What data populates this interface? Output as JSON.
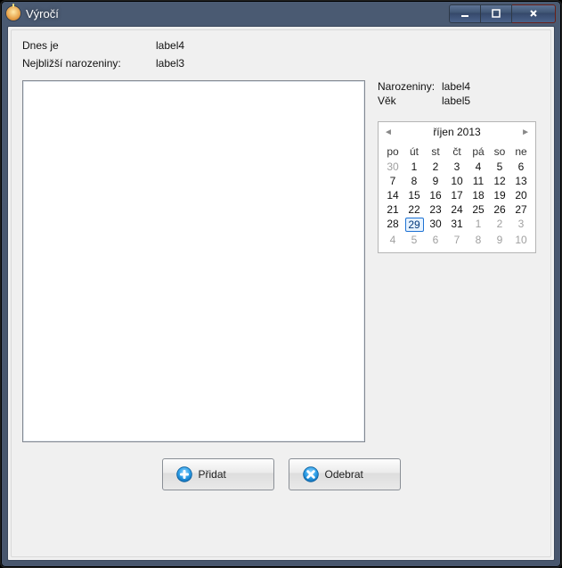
{
  "window": {
    "title": "Výročí"
  },
  "top": {
    "today_label": "Dnes je",
    "today_value": "label4",
    "next_label": "Nejbližší narozeniny:",
    "next_value": "label3"
  },
  "side": {
    "bday_label": "Narozeniny:",
    "bday_value": "label4",
    "age_label": "Věk",
    "age_value": "label5"
  },
  "calendar": {
    "caption": "říjen 2013",
    "prev_glyph": "◄",
    "next_glyph": "►",
    "day_headers": [
      "po",
      "út",
      "st",
      "čt",
      "pá",
      "so",
      "ne"
    ],
    "weeks": [
      [
        {
          "d": 30,
          "other": true
        },
        {
          "d": 1
        },
        {
          "d": 2
        },
        {
          "d": 3
        },
        {
          "d": 4
        },
        {
          "d": 5
        },
        {
          "d": 6
        }
      ],
      [
        {
          "d": 7
        },
        {
          "d": 8
        },
        {
          "d": 9
        },
        {
          "d": 10
        },
        {
          "d": 11
        },
        {
          "d": 12
        },
        {
          "d": 13
        }
      ],
      [
        {
          "d": 14
        },
        {
          "d": 15
        },
        {
          "d": 16
        },
        {
          "d": 17
        },
        {
          "d": 18
        },
        {
          "d": 19
        },
        {
          "d": 20
        }
      ],
      [
        {
          "d": 21
        },
        {
          "d": 22
        },
        {
          "d": 23
        },
        {
          "d": 24
        },
        {
          "d": 25
        },
        {
          "d": 26
        },
        {
          "d": 27
        }
      ],
      [
        {
          "d": 28
        },
        {
          "d": 29,
          "today": true
        },
        {
          "d": 30
        },
        {
          "d": 31
        },
        {
          "d": 1,
          "other": true
        },
        {
          "d": 2,
          "other": true
        },
        {
          "d": 3,
          "other": true
        }
      ],
      [
        {
          "d": 4,
          "other": true
        },
        {
          "d": 5,
          "other": true
        },
        {
          "d": 6,
          "other": true
        },
        {
          "d": 7,
          "other": true
        },
        {
          "d": 8,
          "other": true
        },
        {
          "d": 9,
          "other": true
        },
        {
          "d": 10,
          "other": true
        }
      ]
    ]
  },
  "buttons": {
    "add_label": "Přidat",
    "remove_label": "Odebrat"
  }
}
